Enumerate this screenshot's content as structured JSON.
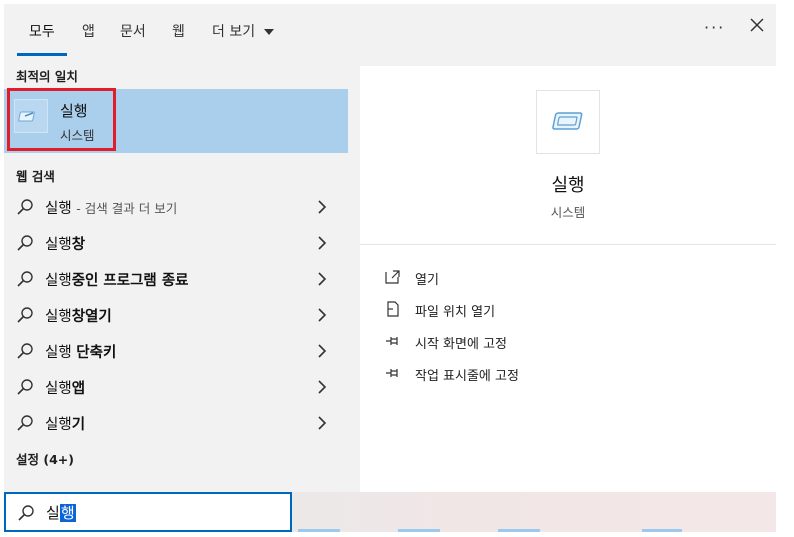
{
  "tabs": [
    {
      "label": "모두",
      "active": true
    },
    {
      "label": "앱"
    },
    {
      "label": "문서"
    },
    {
      "label": "웹"
    },
    {
      "label": "더 보기"
    }
  ],
  "header": {
    "more_icon": "ellipsis-icon",
    "close_icon": "close-icon"
  },
  "sections": {
    "best_match": "최적의 일치",
    "web_search": "웹 검색",
    "settings": "설정 (4+)"
  },
  "best_match": {
    "title": "실행",
    "subtitle": "시스템",
    "icon": "run-dialog-icon"
  },
  "web_results": [
    {
      "pre": "실행",
      "bold": "",
      "suffix": "- 검색 결과 더 보기"
    },
    {
      "pre": "실행",
      "bold": "창",
      "suffix": ""
    },
    {
      "pre": "실행",
      "bold": "중인 프로그램 종료",
      "suffix": ""
    },
    {
      "pre": "실행",
      "bold": "창열기",
      "suffix": ""
    },
    {
      "pre": "실행 ",
      "bold": "단축키",
      "suffix": ""
    },
    {
      "pre": "실행",
      "bold": "앱",
      "suffix": ""
    },
    {
      "pre": "실행",
      "bold": "기",
      "suffix": ""
    }
  ],
  "preview": {
    "title": "실행",
    "subtitle": "시스템",
    "actions": [
      {
        "label": "열기",
        "icon": "open-icon"
      },
      {
        "label": "파일 위치 열기",
        "icon": "file-location-icon"
      },
      {
        "label": "시작 화면에 고정",
        "icon": "pin-icon"
      },
      {
        "label": "작업 표시줄에 고정",
        "icon": "pin-icon"
      }
    ]
  },
  "search": {
    "typed": "실",
    "selected": "행"
  },
  "colors": {
    "accent": "#0067c0",
    "selection": "#aacfed",
    "highlight_border": "#e11d2a"
  }
}
